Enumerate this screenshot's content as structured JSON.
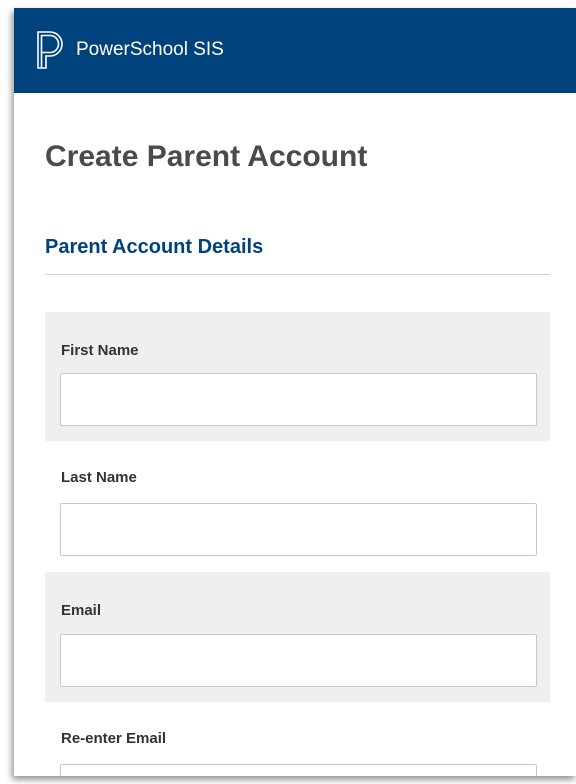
{
  "header": {
    "app_title": "PowerSchool SIS",
    "brand_color": "#00427c"
  },
  "page": {
    "title": "Create Parent Account"
  },
  "section": {
    "title": "Parent Account Details"
  },
  "form": {
    "fields": [
      {
        "label": "First Name",
        "value": "",
        "placeholder": ""
      },
      {
        "label": "Last Name",
        "value": "",
        "placeholder": ""
      },
      {
        "label": "Email",
        "value": "",
        "placeholder": ""
      },
      {
        "label": "Re-enter Email",
        "value": "",
        "placeholder": ""
      }
    ]
  }
}
